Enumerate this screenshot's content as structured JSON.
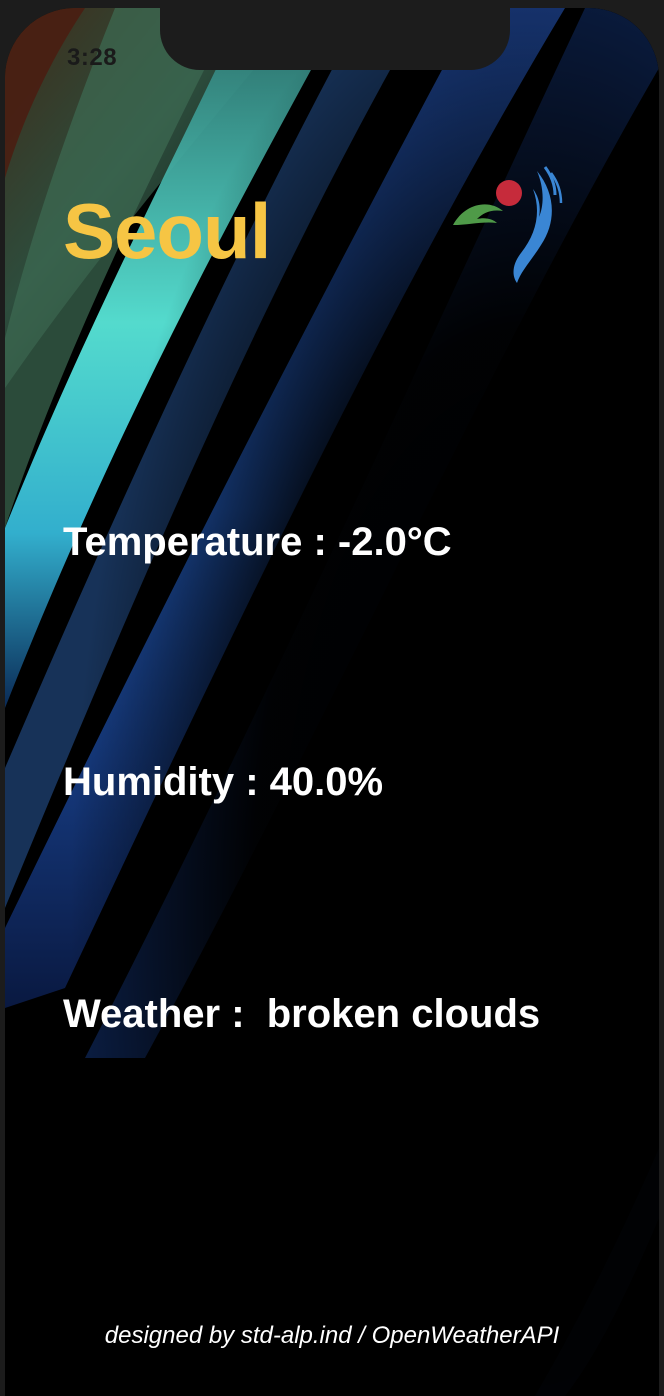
{
  "status_bar": {
    "time": "3:28"
  },
  "header": {
    "city": "Seoul",
    "logo_icon": "seoul-city-logo-icon"
  },
  "weather": {
    "temperature_text": "Temperature : -2.0°C",
    "humidity_text": "Humidity : 40.0%",
    "description_text": "Weather :  broken clouds"
  },
  "footer": {
    "credit": "designed by std-alp.ind / OpenWeatherAPI"
  },
  "colors": {
    "city_title": "#f6c544",
    "text": "#ffffff",
    "background": "#000000",
    "logo_red": "#c62b3b",
    "logo_green": "#4f9a48",
    "logo_blue": "#3a86d4"
  }
}
